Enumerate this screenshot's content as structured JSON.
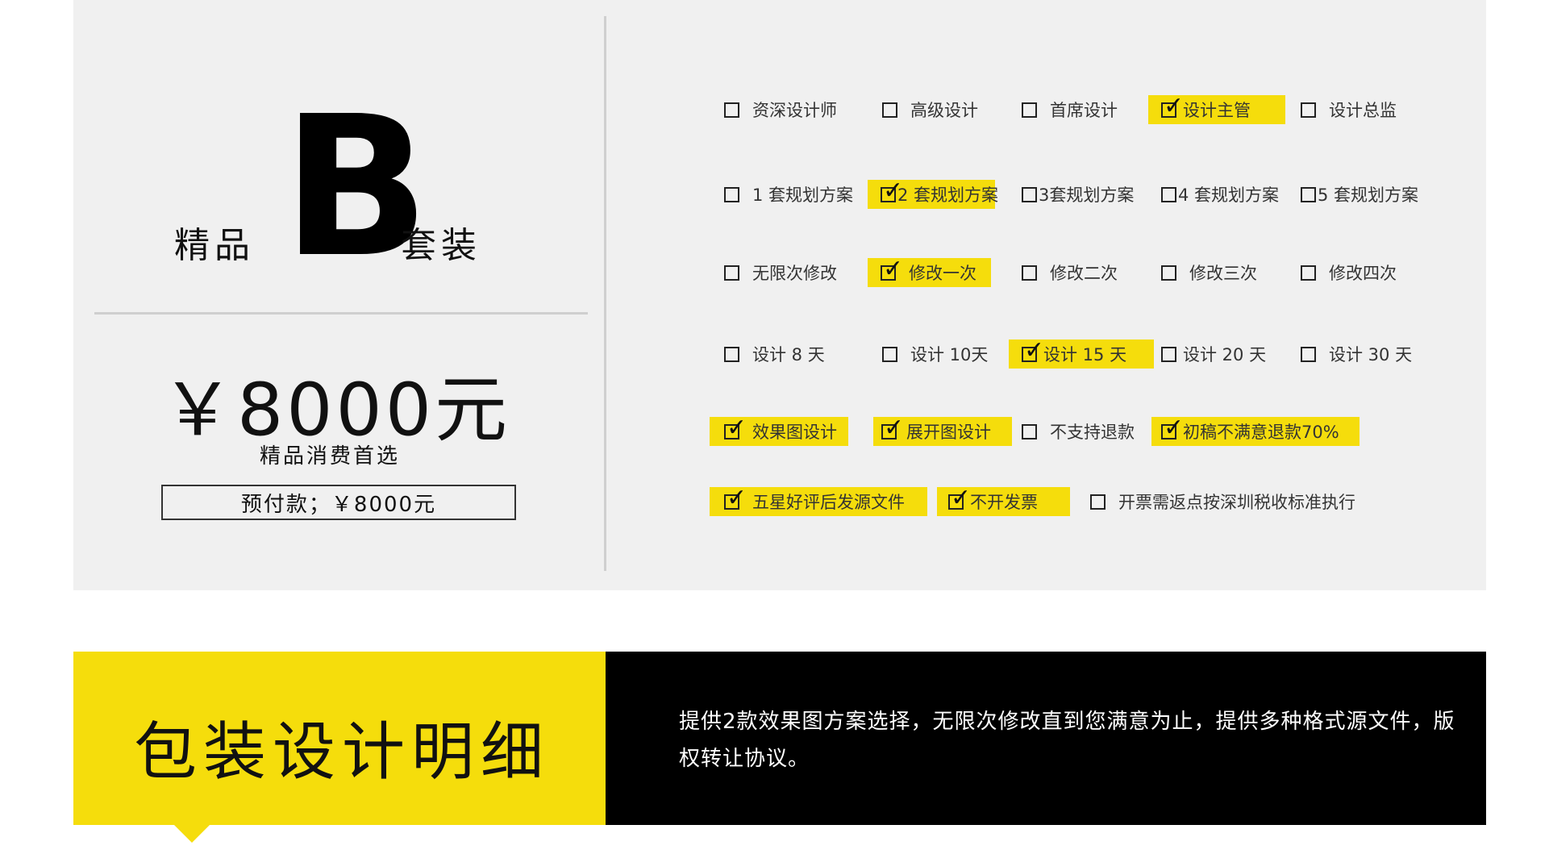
{
  "package": {
    "prefix": "精品",
    "letter": "B",
    "suffix": "套装",
    "price": "￥8000元",
    "subtitle": "精品消费首选",
    "deposit": "预付款；￥8000元"
  },
  "options": {
    "row1": [
      {
        "label": "资深设计师",
        "checked": false
      },
      {
        "label": "高级设计",
        "checked": false
      },
      {
        "label": "首席设计",
        "checked": false
      },
      {
        "label": "设计主管",
        "checked": true
      },
      {
        "label": "设计总监",
        "checked": false
      }
    ],
    "row2": [
      {
        "label": "1 套规划方案",
        "checked": false
      },
      {
        "label": "2 套规划方案",
        "checked": true
      },
      {
        "label": "3套规划方案",
        "checked": false
      },
      {
        "label": "4 套规划方案",
        "checked": false
      },
      {
        "label": "5 套规划方案",
        "checked": false
      }
    ],
    "row3": [
      {
        "label": "无限次修改",
        "checked": false
      },
      {
        "label": "修改一次",
        "checked": true
      },
      {
        "label": "修改二次",
        "checked": false
      },
      {
        "label": "修改三次",
        "checked": false
      },
      {
        "label": "修改四次",
        "checked": false
      }
    ],
    "row4": [
      {
        "label": "设计 8 天",
        "checked": false
      },
      {
        "label": "设计 10天",
        "checked": false
      },
      {
        "label": "设计 15 天",
        "checked": true
      },
      {
        "label": "设计 20 天",
        "checked": false
      },
      {
        "label": "设计 30 天",
        "checked": false
      }
    ],
    "row5": [
      {
        "label": "效果图设计",
        "checked": true
      },
      {
        "label": "展开图设计",
        "checked": true
      },
      {
        "label": "不支持退款",
        "checked": false
      },
      {
        "label": "初稿不满意退款70%",
        "checked": true
      }
    ],
    "row6": [
      {
        "label": "五星好评后发源文件",
        "checked": true
      },
      {
        "label": "不开发票",
        "checked": true
      },
      {
        "label": "开票需返点按深圳税收标准执行",
        "checked": false
      }
    ]
  },
  "details": {
    "title": "包装设计明细",
    "description": "提供2款效果图方案选择，无限次修改直到您满意为止，提供多种格式源文件，版权转让协议。"
  },
  "colors": {
    "highlight": "#f5dd0c",
    "panel": "#f0f0f0",
    "dark": "#000000"
  }
}
